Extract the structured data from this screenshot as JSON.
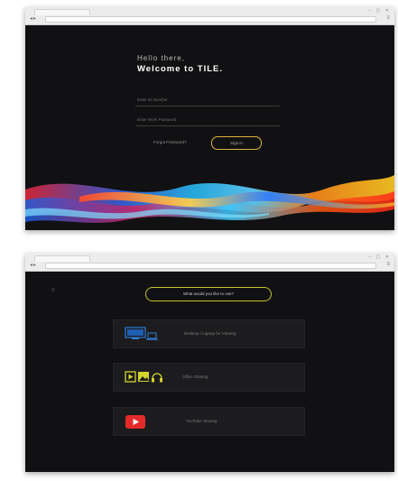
{
  "login": {
    "greeting": "Hello there,",
    "welcome": "Welcome to TILE.",
    "email_placeholder": "Enter ID Number",
    "password_placeholder": "Enter Work Password",
    "forgot_label": "Forgot Password?",
    "signin_label": "Sign in"
  },
  "menu": {
    "prompt": "What would you like to use?",
    "options": [
      {
        "label": "Desktop / Laptop for Viewing",
        "icon": "monitor-icon"
      },
      {
        "label": "Office Sharing",
        "icon": "media-icon"
      },
      {
        "label": "YouTube Sharing",
        "icon": "youtube-icon"
      }
    ]
  },
  "colors": {
    "background": "#111113",
    "card": "#1c1c1e",
    "signin_border": "#d9b43a",
    "prompt_border": "#c9c130",
    "youtube_red": "#e32b2b",
    "media_yellow": "#d4d42c",
    "monitor_blue": "#2f7bd6"
  }
}
